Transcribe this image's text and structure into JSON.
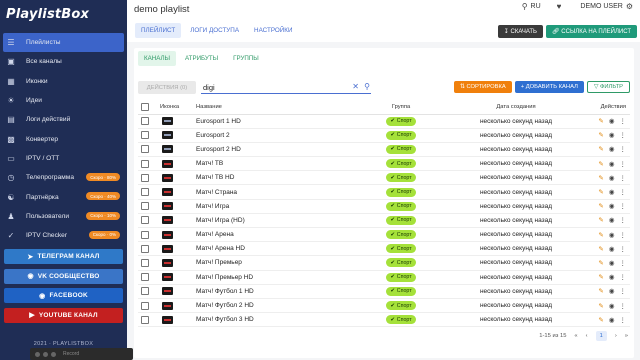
{
  "app": {
    "logo": "PlaylistBox",
    "copyright": "2021 · PLAYLISTBOX"
  },
  "sidebar": {
    "items": [
      {
        "label": "Плейлисты",
        "icon": "playlist-icon",
        "active": true
      },
      {
        "label": "Все каналы",
        "icon": "tv-icon"
      },
      {
        "label": "Иконки",
        "icon": "image-icon"
      },
      {
        "label": "Идеи",
        "icon": "lightbulb-icon"
      },
      {
        "label": "Логи действий",
        "icon": "log-icon"
      },
      {
        "label": "Конвертер",
        "icon": "convert-icon"
      },
      {
        "label": "IPTV / OTT",
        "icon": "monitor-icon"
      },
      {
        "label": "Телепрограмма",
        "icon": "calendar-icon",
        "badge": "Скоро · 80%"
      },
      {
        "label": "Партнёрка",
        "icon": "partner-icon",
        "badge": "Скоро · 40%"
      },
      {
        "label": "Пользователи",
        "icon": "users-icon",
        "badge": "Скоро · 10%"
      },
      {
        "label": "IPTV Checker",
        "icon": "check-icon",
        "badge": "Скоро · 0%"
      }
    ],
    "social": {
      "telegram": "ТЕЛЕГРАМ КАНАЛ",
      "vk": "VK СООБЩЕСТВО",
      "facebook": "FACEBOOK",
      "youtube": "YOUTUBE КАНАЛ"
    }
  },
  "recorder": {
    "label": "Record"
  },
  "header": {
    "title": "demo playlist",
    "tabs": [
      "ПЛЕЙЛИСТ",
      "ЛОГИ ДОСТУПА",
      "НАСТРОЙКИ"
    ],
    "lang": "RU",
    "user": "DEMO USER",
    "download": "СКАЧАТЬ",
    "link": "ССЫЛКА НА ПЛЕЙЛИСТ"
  },
  "subtabs": [
    "КАНАЛЫ",
    "АТРИБУТЫ",
    "ГРУППЫ"
  ],
  "toolbar": {
    "actions": "ДЕЙСТВИЯ (0)",
    "search_value": "digi",
    "sort": "СОРТИРОВКА",
    "add": "ДОБАВИТЬ КАНАЛ",
    "filter": "ФИЛЬТР"
  },
  "table": {
    "headers": {
      "icon": "Иконка",
      "name": "Название",
      "group": "Группа",
      "date": "Дата создания",
      "actions": "Действия"
    },
    "rows": [
      {
        "name": "Eurosport 1 HD",
        "group": "Спорт",
        "date": "несколько секунд назад",
        "icon": "eurosport-logo-icon"
      },
      {
        "name": "Eurosport 2",
        "group": "Спорт",
        "date": "несколько секунд назад",
        "icon": "eurosport-logo-icon"
      },
      {
        "name": "Eurosport 2 HD",
        "group": "Спорт",
        "date": "несколько секунд назад",
        "icon": "eurosport-logo-icon"
      },
      {
        "name": "Матч! ТВ",
        "group": "Спорт",
        "date": "несколько секунд назад",
        "icon": "match-logo-icon"
      },
      {
        "name": "Матч! ТВ HD",
        "group": "Спорт",
        "date": "несколько секунд назад",
        "icon": "match-logo-icon"
      },
      {
        "name": "Матч! Страна",
        "group": "Спорт",
        "date": "несколько секунд назад",
        "icon": "match-logo-icon"
      },
      {
        "name": "Матч! Игра",
        "group": "Спорт",
        "date": "несколько секунд назад",
        "icon": "match-logo-icon"
      },
      {
        "name": "Матч! Игра (HD)",
        "group": "Спорт",
        "date": "несколько секунд назад",
        "icon": "match-logo-icon"
      },
      {
        "name": "Матч! Арена",
        "group": "Спорт",
        "date": "несколько секунд назад",
        "icon": "match-logo-icon"
      },
      {
        "name": "Матч! Арена HD",
        "group": "Спорт",
        "date": "несколько секунд назад",
        "icon": "match-logo-icon"
      },
      {
        "name": "Матч! Премьер",
        "group": "Спорт",
        "date": "несколько секунд назад",
        "icon": "match-logo-icon"
      },
      {
        "name": "Матч! Премьер HD",
        "group": "Спорт",
        "date": "несколько секунд назад",
        "icon": "match-logo-icon"
      },
      {
        "name": "Матч! Футбол 1 HD",
        "group": "Спорт",
        "date": "несколько секунд назад",
        "icon": "match-logo-icon"
      },
      {
        "name": "Матч! Футбол 2 HD",
        "group": "Спорт",
        "date": "несколько секунд назад",
        "icon": "match-logo-icon"
      },
      {
        "name": "Матч! Футбол 3 HD",
        "group": "Спорт",
        "date": "несколько секунд назад",
        "icon": "match-logo-icon"
      }
    ]
  },
  "pager": {
    "range": "1-15 из 15",
    "page": "1"
  },
  "colors": {
    "sidebar": "#1f2d55",
    "active": "#3c64c9",
    "sport_badge": "#a5e13a",
    "sort": "#f0800c",
    "add": "#2f6fd1",
    "link": "#1f9a7a"
  }
}
